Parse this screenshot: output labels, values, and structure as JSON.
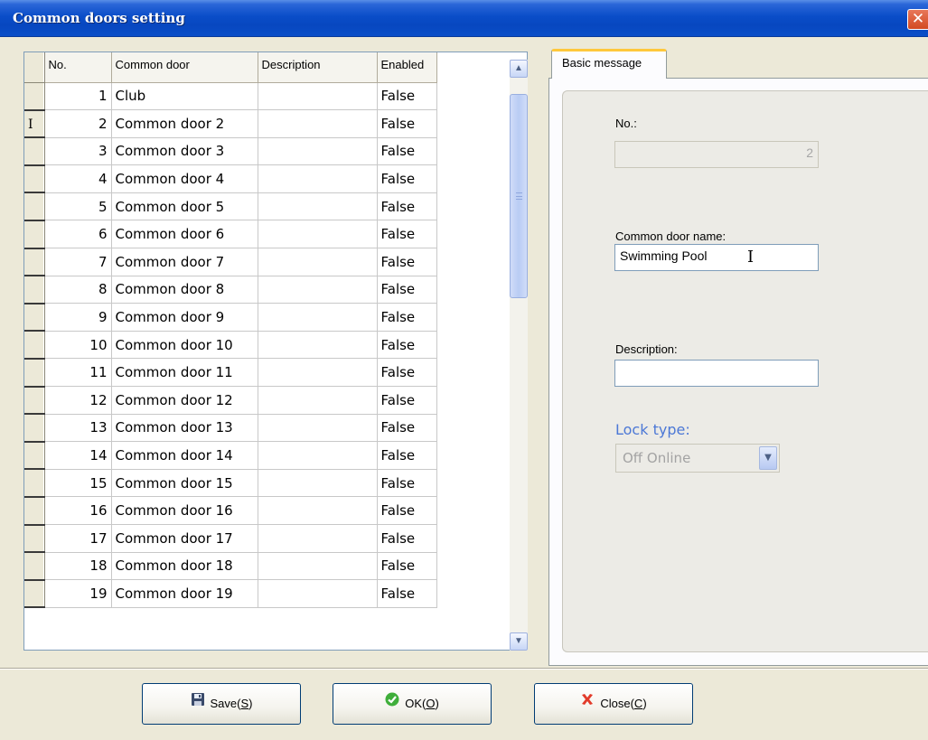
{
  "window": {
    "title": "Common doors setting",
    "close_glyph": "✕"
  },
  "grid": {
    "columns": [
      "No.",
      "Common door",
      "Description",
      "Enabled"
    ],
    "rows": [
      {
        "no": "1",
        "name": "Club",
        "desc": "",
        "enabled": "False"
      },
      {
        "no": "2",
        "name": "Common door 2",
        "desc": "",
        "enabled": "False"
      },
      {
        "no": "3",
        "name": "Common door 3",
        "desc": "",
        "enabled": "False"
      },
      {
        "no": "4",
        "name": "Common door 4",
        "desc": "",
        "enabled": "False"
      },
      {
        "no": "5",
        "name": "Common door 5",
        "desc": "",
        "enabled": "False"
      },
      {
        "no": "6",
        "name": "Common door 6",
        "desc": "",
        "enabled": "False"
      },
      {
        "no": "7",
        "name": "Common door 7",
        "desc": "",
        "enabled": "False"
      },
      {
        "no": "8",
        "name": "Common door 8",
        "desc": "",
        "enabled": "False"
      },
      {
        "no": "9",
        "name": "Common door 9",
        "desc": "",
        "enabled": "False"
      },
      {
        "no": "10",
        "name": "Common door 10",
        "desc": "",
        "enabled": "False"
      },
      {
        "no": "11",
        "name": "Common door 11",
        "desc": "",
        "enabled": "False"
      },
      {
        "no": "12",
        "name": "Common door 12",
        "desc": "",
        "enabled": "False"
      },
      {
        "no": "13",
        "name": "Common door 13",
        "desc": "",
        "enabled": "False"
      },
      {
        "no": "14",
        "name": "Common door 14",
        "desc": "",
        "enabled": "False"
      },
      {
        "no": "15",
        "name": "Common door 15",
        "desc": "",
        "enabled": "False"
      },
      {
        "no": "16",
        "name": "Common door 16",
        "desc": "",
        "enabled": "False"
      },
      {
        "no": "17",
        "name": "Common door 17",
        "desc": "",
        "enabled": "False"
      },
      {
        "no": "18",
        "name": "Common door 18",
        "desc": "",
        "enabled": "False"
      },
      {
        "no": "19",
        "name": "Common door 19",
        "desc": "",
        "enabled": "False"
      }
    ],
    "current_row_marker": "I"
  },
  "tab": {
    "label": "Basic message"
  },
  "form": {
    "no_label": "No.:",
    "no_value": "2",
    "name_label": "Common door name:",
    "name_value": "Swimming Pool",
    "desc_label": "Description:",
    "desc_value": "",
    "lock_label": "Lock type:",
    "lock_value": "Off Online"
  },
  "buttons": {
    "save": {
      "text": "Save(",
      "key": "S",
      "end": ")"
    },
    "ok": {
      "text": "OK(",
      "key": "O",
      "end": ")"
    },
    "close": {
      "text": "Close(",
      "key": "C",
      "end": ")"
    }
  },
  "colors": {
    "title_bar": "#0a4dc8",
    "lock_label": "#4c78d6",
    "tab_highlight": "#ffc83c",
    "close_red": "#d24a22"
  }
}
